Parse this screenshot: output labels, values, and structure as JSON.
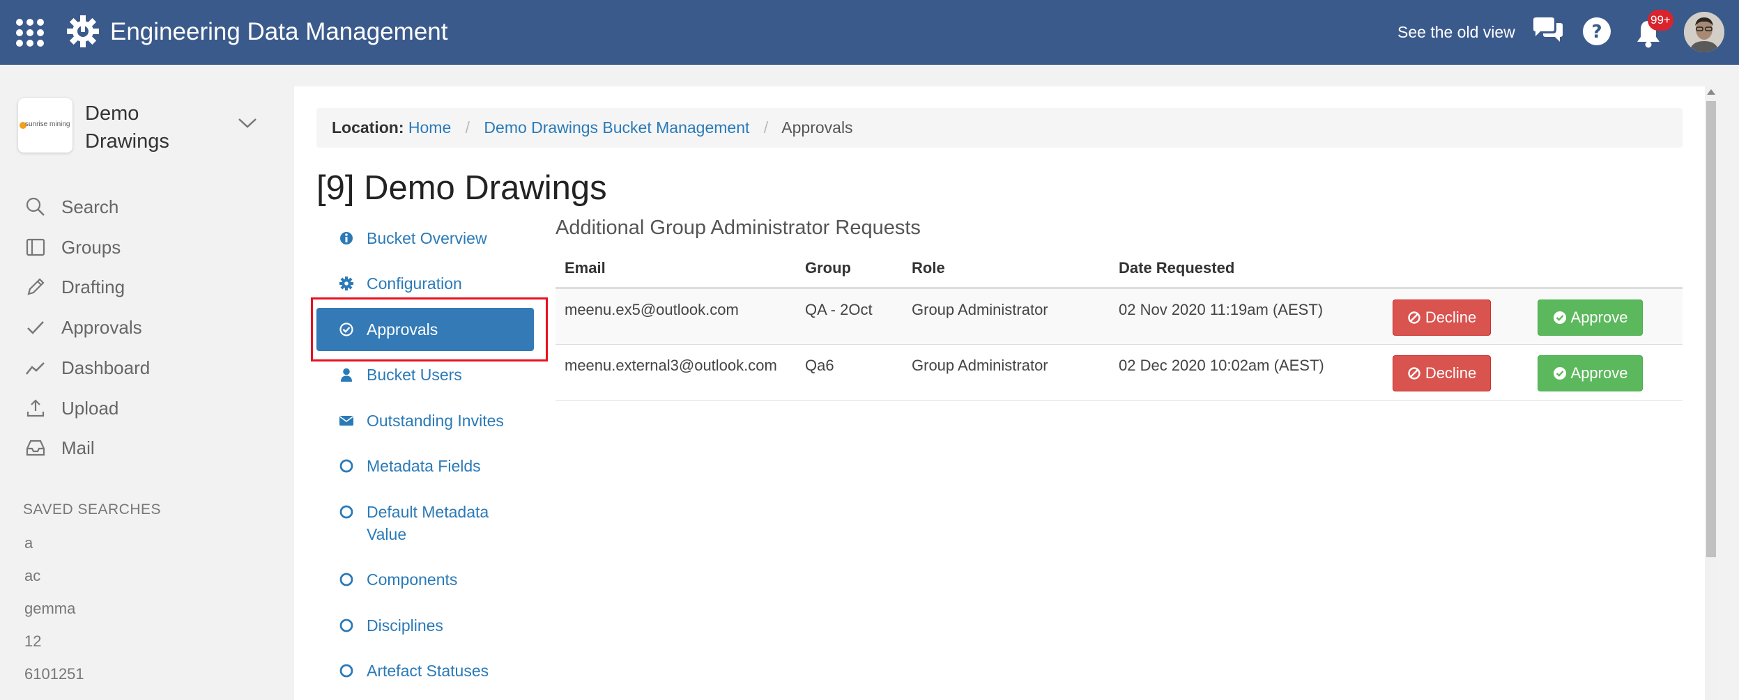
{
  "header": {
    "title": "Engineering Data Management",
    "old_view_label": "See the old view",
    "notification_count": "99+",
    "color": "#3b5a8c"
  },
  "sidebar": {
    "bucket_logo_text": "sunrise mining",
    "bucket_name": "Demo Drawings",
    "nav": [
      {
        "label": "Search",
        "icon": "search-icon"
      },
      {
        "label": "Groups",
        "icon": "groups-icon"
      },
      {
        "label": "Drafting",
        "icon": "pencil-icon"
      },
      {
        "label": "Approvals",
        "icon": "check-icon"
      },
      {
        "label": "Dashboard",
        "icon": "chart-line-icon"
      },
      {
        "label": "Upload",
        "icon": "upload-icon"
      },
      {
        "label": "Mail",
        "icon": "inbox-icon"
      }
    ],
    "saved_searches_header": "SAVED SEARCHES",
    "saved_searches": [
      "a",
      "ac",
      "gemma",
      "12",
      "6101251"
    ]
  },
  "breadcrumb": {
    "label": "Location:",
    "items": [
      "Home",
      "Demo Drawings Bucket Management",
      "Approvals"
    ]
  },
  "page_title": "[9] Demo Drawings",
  "subnav": {
    "items": [
      {
        "label": "Bucket Overview",
        "icon": "info-circle-icon"
      },
      {
        "label": "Configuration",
        "icon": "gear-icon"
      },
      {
        "label": "Approvals",
        "icon": "check-circle-icon",
        "active": true
      },
      {
        "label": "Bucket Users",
        "icon": "user-icon"
      },
      {
        "label": "Outstanding Invites",
        "icon": "envelope-icon"
      },
      {
        "label": "Metadata Fields",
        "icon": "circle-icon"
      },
      {
        "label": "Default Metadata Value",
        "label_line1": "Default Metadata",
        "label_line2": "Value",
        "icon": "circle-icon"
      },
      {
        "label": "Components",
        "icon": "circle-icon"
      },
      {
        "label": "Disciplines",
        "icon": "circle-icon"
      },
      {
        "label": "Artefact Statuses",
        "icon": "circle-icon"
      }
    ],
    "active_color": "#337ab7",
    "link_color": "#2a7ab8"
  },
  "requests": {
    "title": "Additional Group Administrator Requests",
    "columns": [
      "Email",
      "Group",
      "Role",
      "Date Requested"
    ],
    "rows": [
      {
        "email": "meenu.ex5@outlook.com",
        "group": "QA - 2Oct",
        "role": "Group Administrator",
        "date": "02 Nov 2020 11:19am (AEST)"
      },
      {
        "email": "meenu.external3@outlook.com",
        "group": "Qa6",
        "role": "Group Administrator",
        "date": "02 Dec 2020 10:02am (AEST)"
      }
    ],
    "decline_label": "Decline",
    "approve_label": "Approve",
    "decline_color": "#d9534f",
    "approve_color": "#5cb85c"
  }
}
